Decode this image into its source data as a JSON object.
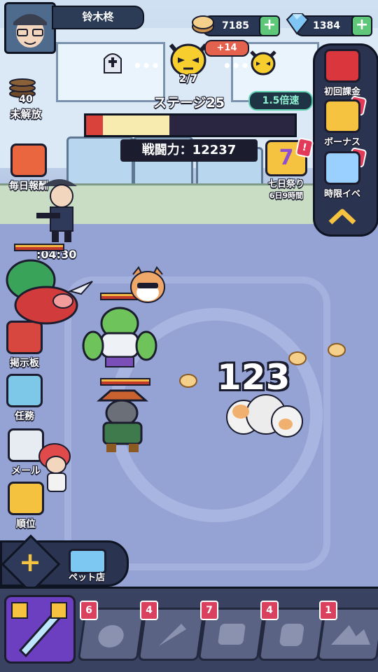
{
  "player": {
    "name": "铃木柊"
  },
  "currency": {
    "coins": "7185",
    "gems": "1384"
  },
  "stage": {
    "waves": "2/7",
    "reward_badge": "+14",
    "title": "ステージ25",
    "speed": "1.5倍速",
    "power": "戦闘力：12237",
    "progress": 0.4
  },
  "left_menu": {
    "locked_count": "40",
    "locked_label": "未解放",
    "daily_reward": "毎日報酬",
    "bulletin": "掲示板",
    "tasks": "任務",
    "mail": "メール",
    "ranking": "順位"
  },
  "right_menu": {
    "first_purchase": "初回課金",
    "bonus": "ボーナス",
    "limited_event": "時限イベ",
    "festival": "七日祭り",
    "festival_timer": "6日9時間"
  },
  "timer": "04:30",
  "damage_number": "123",
  "bottom": {
    "pet_shop": "ペット店",
    "tab_badges": [
      "6",
      "4",
      "7",
      "4",
      "1"
    ]
  },
  "colors": {
    "accent_green": "#5fc77a",
    "badge_red": "#e43a5a",
    "active_tab": "#6b3fbf"
  },
  "icons": [
    "gold-coin-icon",
    "gem-icon",
    "plus-icon",
    "tombstone-icon",
    "demon-skull-icon",
    "chevron-up-icon",
    "gift-box-icon",
    "paw-icon",
    "sword-icon",
    "envelope-icon",
    "trophy-icon",
    "shop-icon"
  ]
}
